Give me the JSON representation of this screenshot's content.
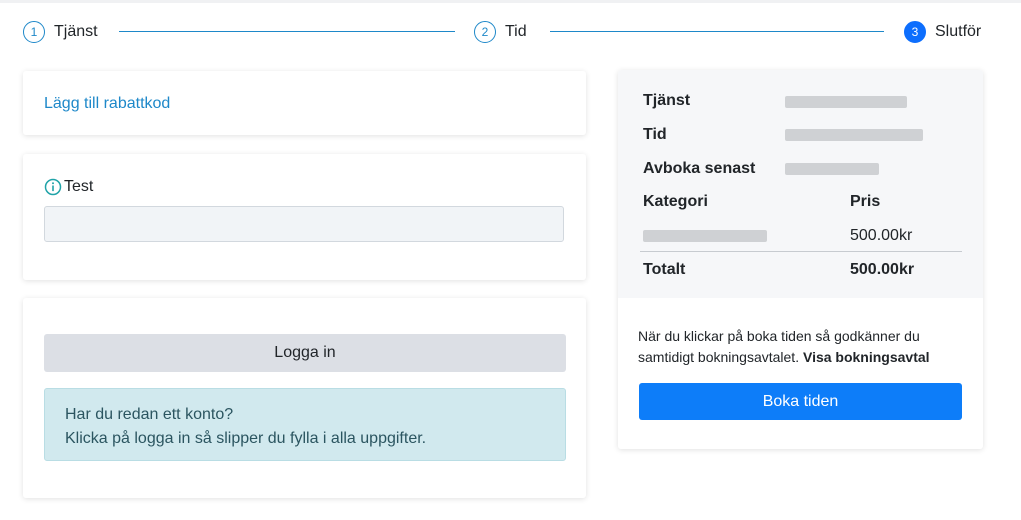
{
  "stepper": {
    "steps": [
      {
        "number": "1",
        "label": "Tjänst"
      },
      {
        "number": "2",
        "label": "Tid"
      },
      {
        "number": "3",
        "label": "Slutför"
      }
    ]
  },
  "discount": {
    "link_label": "Lägg till rabattkod"
  },
  "custom_field": {
    "label": "Test",
    "value": ""
  },
  "login": {
    "button_label": "Logga in",
    "info_line1": "Har du redan ett konto?",
    "info_line2": "Klicka på logga in så slipper du fylla i alla uppgifter."
  },
  "summary": {
    "service_label": "Tjänst",
    "time_label": "Tid",
    "cancel_label": "Avboka senast",
    "category_header": "Kategori",
    "price_header": "Pris",
    "item_price": "500.00kr",
    "total_label": "Totalt",
    "total_price": "500.00kr",
    "notice_text": "När du klickar på boka tiden så godkänner du samtidigt bokningsavtalet.",
    "notice_link": "Visa bokningsavtal",
    "book_button": "Boka tiden"
  },
  "colors": {
    "accent": "#1e88c9",
    "primary": "#0d7df9",
    "info_bg": "#d1e9ee"
  }
}
